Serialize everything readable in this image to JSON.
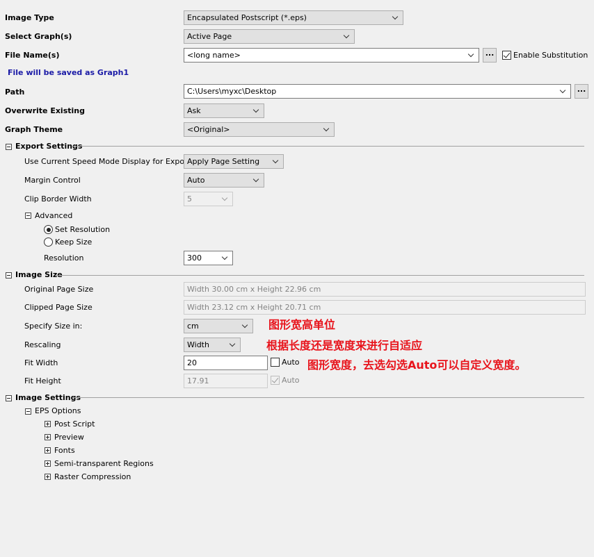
{
  "top": {
    "image_type": {
      "label": "Image Type",
      "value": "Encapsulated Postscript (*.eps)"
    },
    "select_graphs": {
      "label": "Select Graph(s)",
      "value": "Active Page"
    },
    "file_names": {
      "label": "File Name(s)",
      "value": "<long name>",
      "browse": "...",
      "enable_substitution": "Enable Substitution",
      "enable_substitution_checked": true
    },
    "save_note": "File will be saved as Graph1",
    "path": {
      "label": "Path",
      "value": "C:\\Users\\myxc\\Desktop",
      "browse": "..."
    },
    "overwrite": {
      "label": "Overwrite Existing",
      "value": "Ask"
    },
    "graph_theme": {
      "label": "Graph Theme",
      "value": "<Original>"
    }
  },
  "export_settings": {
    "title": "Export Settings",
    "speed_mode": {
      "label": "Use Current Speed Mode Display for Export",
      "value": "Apply Page Setting"
    },
    "margin_control": {
      "label": "Margin Control",
      "value": "Auto"
    },
    "clip_border": {
      "label": "Clip Border Width",
      "value": "5"
    },
    "advanced": {
      "title": "Advanced",
      "set_resolution": "Set Resolution",
      "keep_size": "Keep Size",
      "selected": "set_resolution",
      "resolution": {
        "label": "Resolution",
        "value": "300"
      }
    }
  },
  "image_size": {
    "title": "Image Size",
    "original_page": {
      "label": "Original Page Size",
      "value": "Width 30.00 cm x Height 22.96 cm"
    },
    "clipped_page": {
      "label": "Clipped Page Size",
      "value": "Width 23.12 cm x Height 20.71 cm"
    },
    "specify_size": {
      "label": "Specify Size in:",
      "value": "cm"
    },
    "rescaling": {
      "label": "Rescaling",
      "value": "Width"
    },
    "fit_width": {
      "label": "Fit Width",
      "value": "20",
      "auto": "Auto",
      "auto_checked": false
    },
    "fit_height": {
      "label": "Fit Height",
      "value": "17.91",
      "auto": "Auto",
      "auto_checked": true
    }
  },
  "image_settings": {
    "title": "Image Settings",
    "eps_options": "EPS Options",
    "items": [
      "Post Script",
      "Preview",
      "Fonts",
      "Semi-transparent Regions",
      "Raster Compression"
    ]
  },
  "annotations": {
    "unit_note": "图形宽高单位",
    "rescale_note": "根据长度还是宽度来进行自适应",
    "width_note": "图形宽度，去选勾选Auto可以自定义宽度。"
  },
  "colors": {
    "annotation": "#e8141c",
    "save_note": "#1a1aa6"
  }
}
